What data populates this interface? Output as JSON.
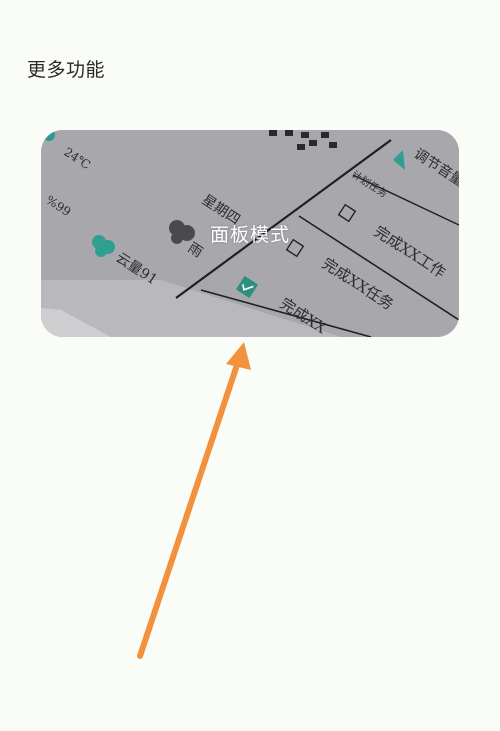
{
  "section": {
    "title": "更多功能"
  },
  "panel_card": {
    "label": "面板模式",
    "illustration": {
      "temperature": "24℃",
      "humidity": "%99",
      "weather_left": "云量91",
      "weekday": "星期四",
      "weather_right": "雨",
      "tasks_header": "计划任务",
      "adjust_volume": "调节音量",
      "task_1": "完成XX工作",
      "task_2": "完成XX任务",
      "task_3": "完成XX"
    }
  },
  "arrow": {
    "color": "#f2923c"
  }
}
